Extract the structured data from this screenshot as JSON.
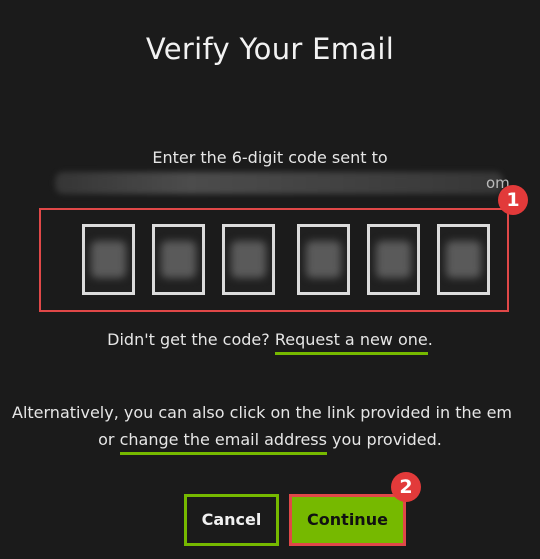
{
  "dialog": {
    "title": "Verify Your Email",
    "instruction": "Enter the 6-digit code sent to",
    "email_suffix": "om",
    "code_digits": [
      "",
      "",
      "",
      "",
      "",
      ""
    ],
    "resend_prefix": "Didn't get the code? ",
    "resend_link": "Request a new one",
    "resend_suffix": ".",
    "alt_line1": "Alternatively, you can also click on the link provided in the em",
    "alt_prefix": "or ",
    "alt_link": "change the email address",
    "alt_suffix": " you provided."
  },
  "buttons": {
    "cancel": "Cancel",
    "continue": "Continue"
  },
  "badges": {
    "one": "1",
    "two": "2"
  },
  "colors": {
    "background": "#1b1b1b",
    "accent_green": "#76b900",
    "highlight_red": "#e04848"
  }
}
